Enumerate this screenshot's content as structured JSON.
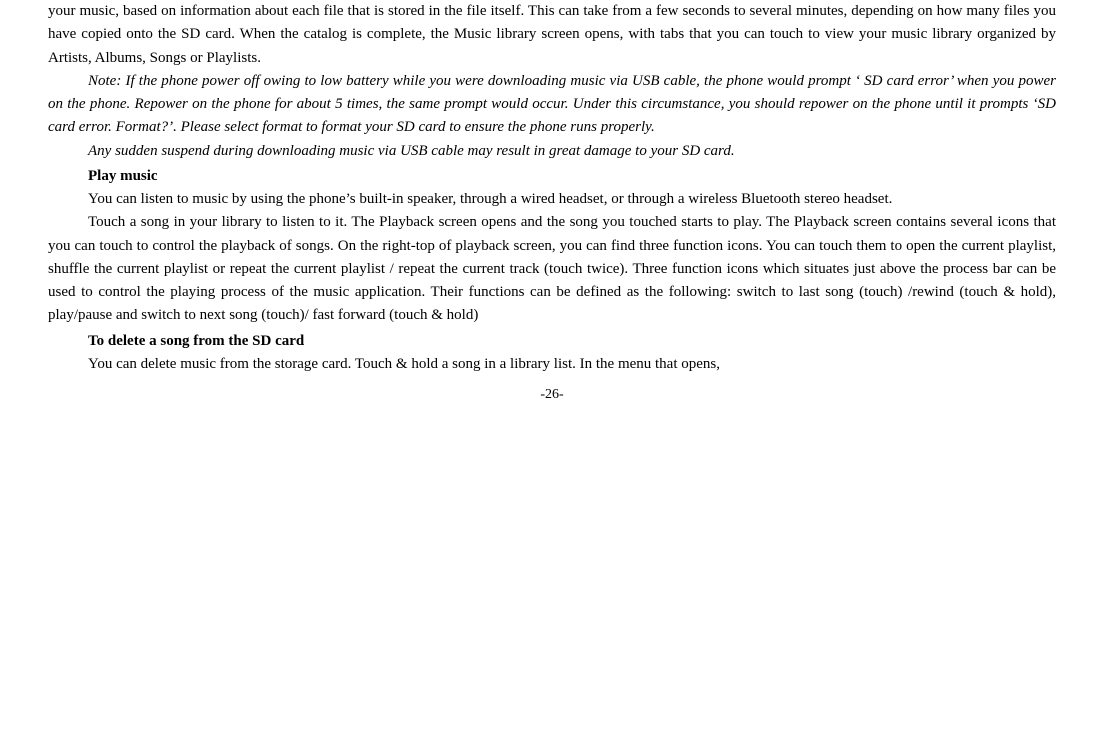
{
  "page": {
    "page_number": "-26-",
    "paragraphs": [
      {
        "id": "intro-text",
        "text": "your music, based on information about each file that is stored in the file itself. This can take from a few seconds to several minutes, depending on how many files you have copied onto the SD card. When the catalog is complete, the Music library screen opens, with tabs that you can touch to view your music library organized by Artists, Albums, Songs or Playlists."
      },
      {
        "id": "note-italic",
        "italic": true,
        "indent": true,
        "text": "Note: If the phone power off owing to low battery while you were downloading music via USB cable, the phone would prompt ‘ SD card error’ when you power on the phone. Repower on the phone for about 5 times, the same prompt would occur. Under this circumstance, you should repower on the phone until it prompts ‘SD card error. Format?’. Please select format to format your SD card to ensure the phone runs properly."
      },
      {
        "id": "sudden-suspend",
        "italic": true,
        "indent": true,
        "text": "Any sudden suspend during downloading music via USB cable may result in great damage to your SD card."
      },
      {
        "id": "play-music-heading",
        "heading": true,
        "text": "Play music"
      },
      {
        "id": "play-music-body",
        "indent": true,
        "text": "You can listen to music by using the phone’s built-in speaker, through a wired headset, or through a wireless Bluetooth stereo headset."
      },
      {
        "id": "touch-song",
        "indent": true,
        "text": "Touch a song in your library to listen to it. The Playback screen opens and the song you touched starts to play. The Playback screen contains several icons that you can touch to control the playback of songs. On the right-top of playback screen, you can find three function icons. You can touch them to open the current playlist, shuffle the current playlist or repeat the current playlist / repeat the current track (touch twice). Three function icons which situates just above the process bar can be used to control the playing process of the music application. Their functions can be defined as the following: switch to last song (touch) /rewind (touch & hold), play/pause and switch to next song (touch)/ fast forward (touch & hold)"
      },
      {
        "id": "delete-heading",
        "heading": true,
        "heading_style": "bold",
        "text": "To delete a song from the SD card"
      },
      {
        "id": "delete-body",
        "indent": true,
        "text": "You can delete music from the storage card. Touch & hold a song in a library list. In the menu that opens,"
      }
    ]
  }
}
